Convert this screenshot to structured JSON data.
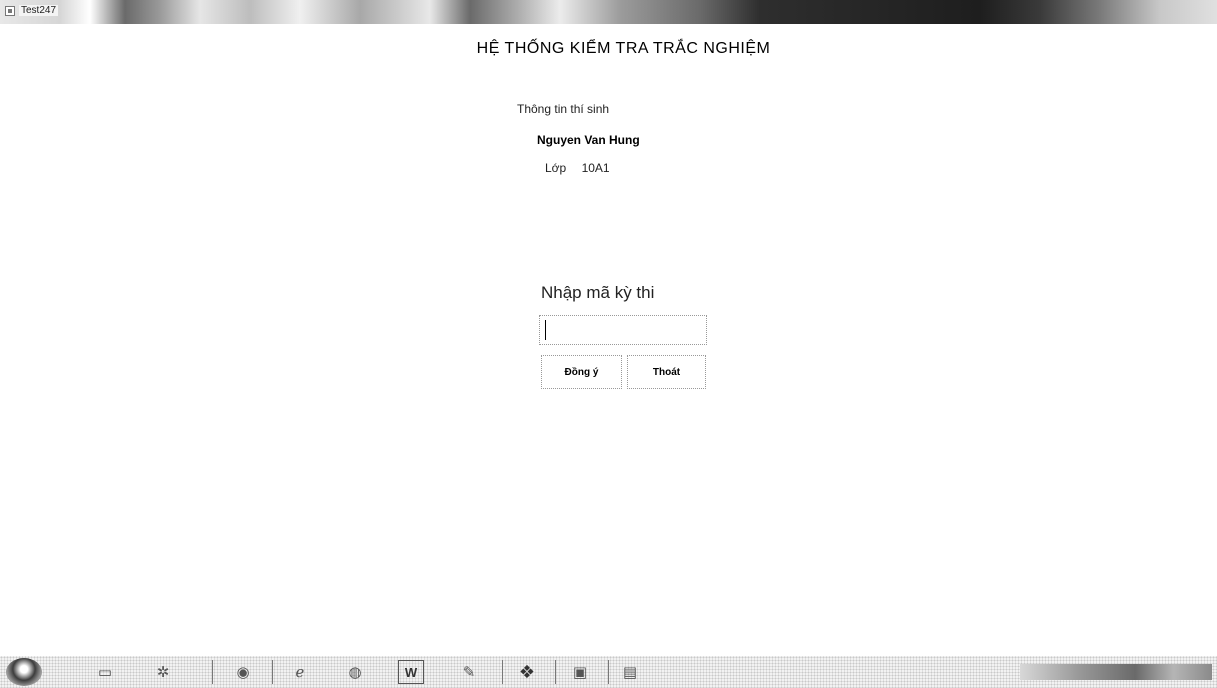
{
  "window": {
    "title": "Test247"
  },
  "header": {
    "title": "HỆ THỐNG KIỂM TRA TRẮC NGHIỆM"
  },
  "candidate": {
    "heading": "Thông tin thí sinh",
    "name": "Nguyen Van Hung",
    "class_label": "Lớp",
    "class_value": "10A1"
  },
  "exam": {
    "code_label": "Nhập mã kỳ thi",
    "code_value": "",
    "ok_label": "Đồng ý",
    "exit_label": "Thoát"
  },
  "taskbar": {
    "items": [
      {
        "icon": "start-orb-icon"
      },
      {
        "icon": "folder-icon"
      },
      {
        "icon": "settings-icon"
      },
      {
        "icon": "chrome-icon"
      },
      {
        "icon": "internet-explorer-icon"
      },
      {
        "icon": "app-icon"
      },
      {
        "icon": "word-icon",
        "text": "W"
      },
      {
        "icon": "paint-icon"
      },
      {
        "icon": "cat-icon"
      },
      {
        "icon": "app-window-icon"
      },
      {
        "icon": "test-app-icon"
      }
    ]
  }
}
